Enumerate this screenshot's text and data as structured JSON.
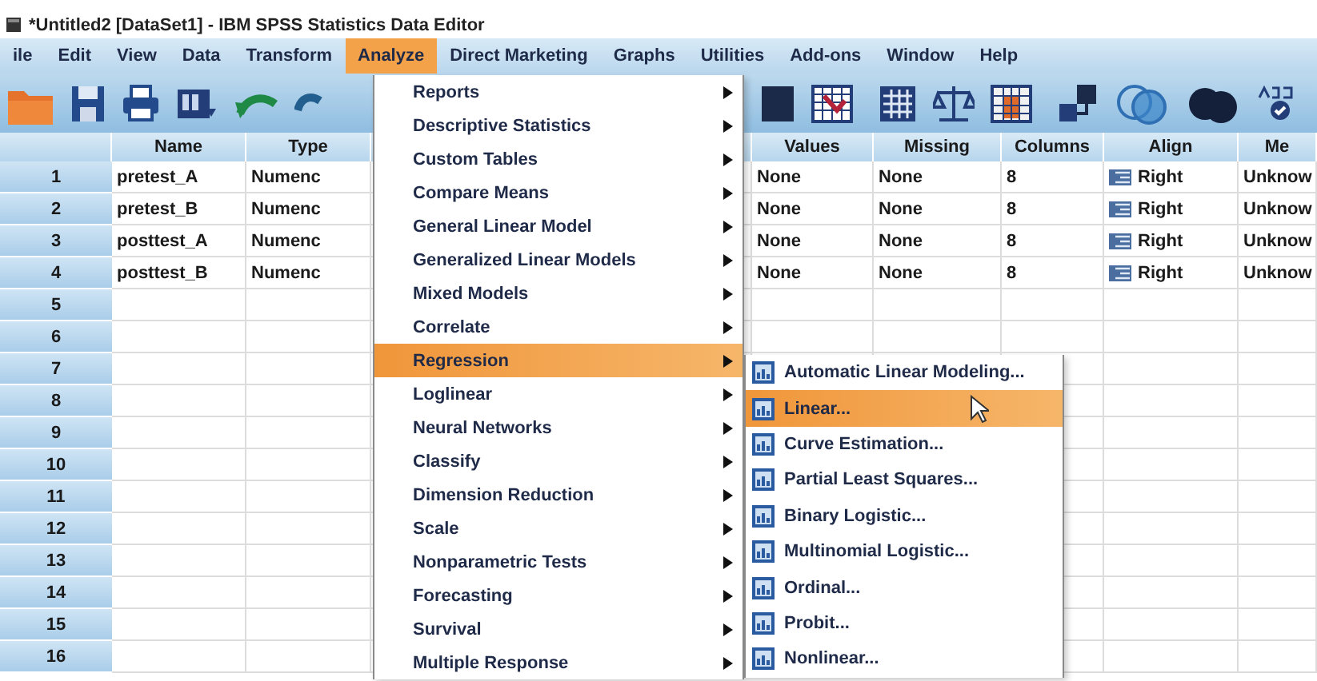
{
  "window": {
    "title": "*Untitled2 [DataSet1] - IBM SPSS Statistics Data Editor"
  },
  "menubar": [
    {
      "label": "ile",
      "selected": false
    },
    {
      "label": "Edit",
      "selected": false
    },
    {
      "label": "View",
      "selected": false
    },
    {
      "label": "Data",
      "selected": false
    },
    {
      "label": "Transform",
      "selected": false
    },
    {
      "label": "Analyze",
      "selected": true
    },
    {
      "label": "Direct Marketing",
      "selected": false
    },
    {
      "label": "Graphs",
      "selected": false
    },
    {
      "label": "Utilities",
      "selected": false
    },
    {
      "label": "Add-ons",
      "selected": false
    },
    {
      "label": "Window",
      "selected": false
    },
    {
      "label": "Help",
      "selected": false
    }
  ],
  "grid": {
    "columns": [
      "Name",
      "Type",
      "Values",
      "Missing",
      "Columns",
      "Align",
      "Me"
    ],
    "rows": [
      {
        "number": "1",
        "cells": [
          "pretest_A",
          "Numenc",
          "None",
          "None",
          "8",
          "Right",
          "Unknow"
        ]
      },
      {
        "number": "2",
        "cells": [
          "pretest_B",
          "Numenc",
          "None",
          "None",
          "8",
          "Right",
          "Unknow"
        ]
      },
      {
        "number": "3",
        "cells": [
          "posttest_A",
          "Numenc",
          "None",
          "None",
          "8",
          "Right",
          "Unknow"
        ]
      },
      {
        "number": "4",
        "cells": [
          "posttest_B",
          "Numenc",
          "None",
          "None",
          "8",
          "Right",
          "Unknow"
        ]
      },
      {
        "number": "5"
      },
      {
        "number": "6"
      },
      {
        "number": "7"
      },
      {
        "number": "8"
      },
      {
        "number": "9"
      },
      {
        "number": "10"
      },
      {
        "number": "11"
      },
      {
        "number": "12"
      },
      {
        "number": "13"
      },
      {
        "number": "14"
      },
      {
        "number": "15"
      },
      {
        "number": "16"
      }
    ]
  },
  "analyze_menu": {
    "items": [
      {
        "label": "Reports",
        "submenu": true,
        "selected": false
      },
      {
        "label": "Descriptive Statistics",
        "submenu": true,
        "selected": false
      },
      {
        "label": "Custom Tables",
        "submenu": true,
        "selected": false
      },
      {
        "label": "Compare Means",
        "submenu": true,
        "selected": false
      },
      {
        "label": "General Linear Model",
        "submenu": true,
        "selected": false
      },
      {
        "label": "Generalized Linear Models",
        "submenu": true,
        "selected": false
      },
      {
        "label": "Mixed Models",
        "submenu": true,
        "selected": false
      },
      {
        "label": "Correlate",
        "submenu": true,
        "selected": false
      },
      {
        "label": "Regression",
        "submenu": true,
        "selected": true
      },
      {
        "label": "Loglinear",
        "submenu": true,
        "selected": false
      },
      {
        "label": "Neural Networks",
        "submenu": true,
        "selected": false
      },
      {
        "label": "Classify",
        "submenu": true,
        "selected": false
      },
      {
        "label": "Dimension Reduction",
        "submenu": true,
        "selected": false
      },
      {
        "label": "Scale",
        "submenu": true,
        "selected": false
      },
      {
        "label": "Nonparametric Tests",
        "submenu": true,
        "selected": false
      },
      {
        "label": "Forecasting",
        "submenu": true,
        "selected": false
      },
      {
        "label": "Survival",
        "submenu": true,
        "selected": false
      },
      {
        "label": "Multiple Response",
        "submenu": true,
        "selected": false
      }
    ]
  },
  "regression_menu": {
    "items": [
      {
        "label": "Automatic Linear Modeling...",
        "selected": false
      },
      {
        "label": "Linear...",
        "selected": true
      },
      {
        "label": "Curve Estimation...",
        "selected": false
      },
      {
        "label": "Partial Least Squares...",
        "selected": false
      },
      {
        "label": "Binary Logistic...",
        "selected": false
      },
      {
        "label": "Multinomial Logistic...",
        "selected": false
      },
      {
        "label": "Ordinal...",
        "selected": false
      },
      {
        "label": "Probit...",
        "selected": false
      },
      {
        "label": "Nonlinear...",
        "selected": false
      }
    ]
  }
}
